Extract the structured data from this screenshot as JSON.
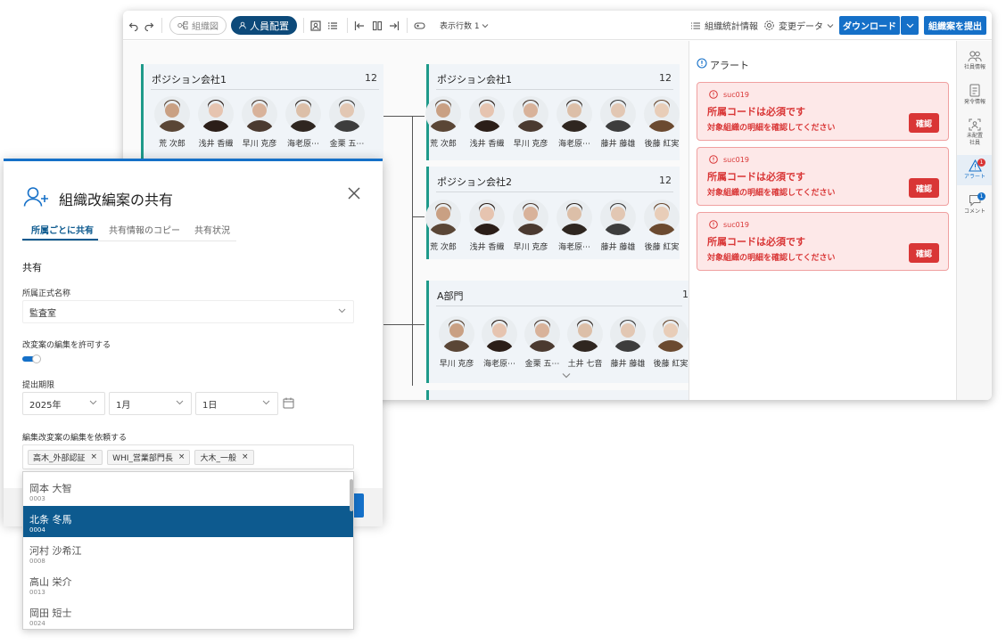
{
  "toolbar": {
    "org_chart": "組織図",
    "staffing": "人員配置",
    "rows": "表示行数 1",
    "stats": "組織統計情報",
    "change_data": "変更データ",
    "download": "ダウンロード",
    "submit": "組織案を提出"
  },
  "org": {
    "cards": [
      {
        "title": "ポジション会社1",
        "count": "12",
        "people": [
          "荒 次郎",
          "浅井 香織",
          "早川 克彦",
          "海老原⋯",
          "金栗 五⋯"
        ]
      },
      {
        "title": "ポジション会社1",
        "count": "12",
        "people": [
          "荒 次郎",
          "浅井 香織",
          "早川 克彦",
          "海老原⋯",
          "藤井 藤雄",
          "後藤 紅実"
        ]
      },
      {
        "title": "ポジション会社2",
        "count": "12",
        "people": [
          "荒 次郎",
          "浅井 香織",
          "早川 克彦",
          "海老原⋯",
          "藤井 藤雄",
          "後藤 紅実"
        ]
      },
      {
        "title": "A部門",
        "count": "1:",
        "people": [
          "早川 克彦",
          "海老原⋯",
          "金栗 五⋯",
          "土井 七音",
          "藤井 藤雄",
          "後藤 紅実"
        ]
      }
    ]
  },
  "alerts": {
    "title": "アラート",
    "items": [
      {
        "code": "suc019",
        "message": "所属コードは必須です",
        "detail": "対象組織の明細を確認してください",
        "action": "確認"
      },
      {
        "code": "suc019",
        "message": "所属コードは必須です",
        "detail": "対象組織の明細を確認してください",
        "action": "確認"
      },
      {
        "code": "suc019",
        "message": "所属コードは必須です",
        "detail": "対象組織の明細を確認してください",
        "action": "確認"
      }
    ]
  },
  "rail": {
    "employee": "社員情報",
    "orders": "発令情報",
    "unassigned": "未配置社員",
    "alert": "アラート",
    "alert_badge": "1",
    "comment": "コメント",
    "comment_badge": "1"
  },
  "modal": {
    "title": "組織改編案の共有",
    "tabs": [
      "所属ごとに共有",
      "共有情報のコピー",
      "共有状況"
    ],
    "section": "共有",
    "dept_label": "所属正式名称",
    "dept_value": "監査室",
    "allow_label": "改変案の編集を許可する",
    "deadline_label": "提出期限",
    "year": "2025年",
    "month": "1月",
    "day": "1日",
    "request_label": "編集改変案の編集を依頼する",
    "chips": [
      "高木_外部認証",
      "WHI_営業部門長",
      "大木_一般"
    ]
  },
  "dropdown": {
    "options": [
      {
        "name": "岡本 大智",
        "code": "0003"
      },
      {
        "name": "北条 冬馬",
        "code": "0004"
      },
      {
        "name": "河村 沙希江",
        "code": "0008"
      },
      {
        "name": "高山 栄介",
        "code": "0013"
      },
      {
        "name": "岡田 短士",
        "code": "0024"
      }
    ]
  },
  "colors": {
    "primary": "#1570c8",
    "navy": "#0d4a7a",
    "accent": "#1e9a8a",
    "danger": "#d93636"
  }
}
